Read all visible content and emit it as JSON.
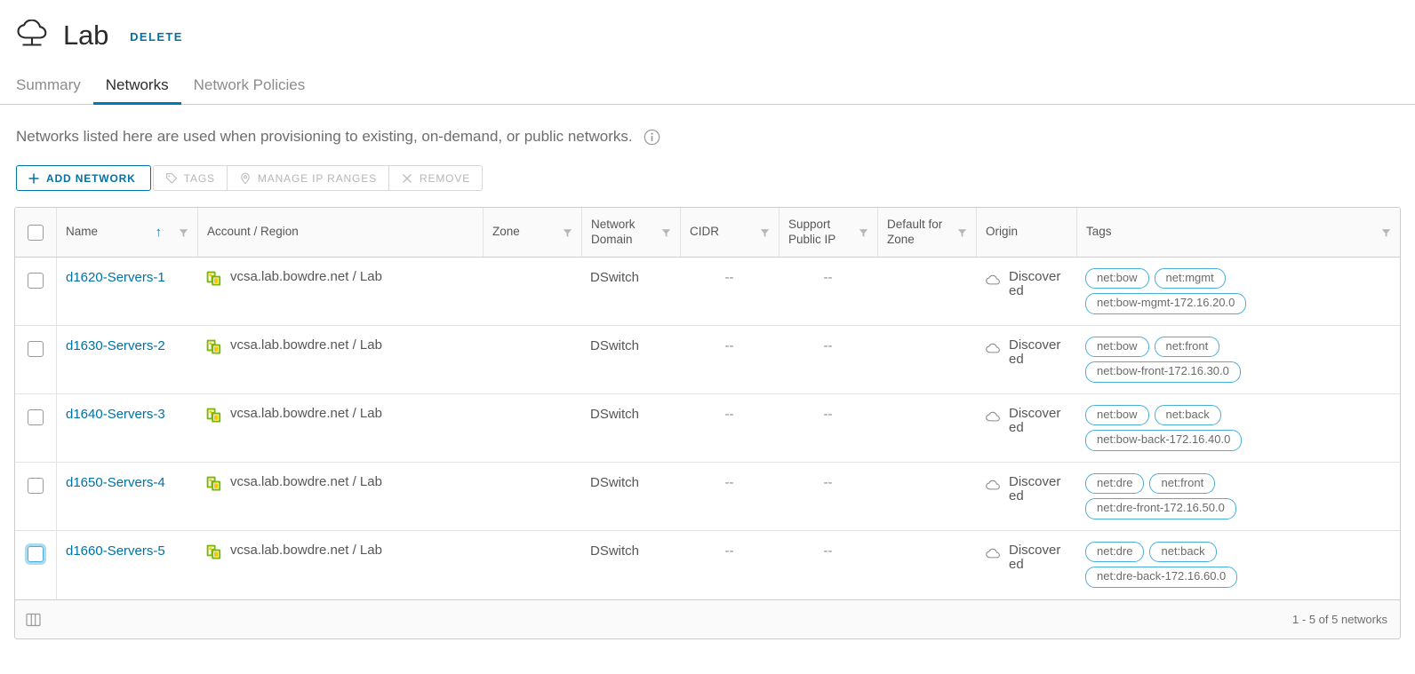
{
  "header": {
    "title": "Lab",
    "logo_icon": "cloud-icon",
    "delete_label": "DELETE"
  },
  "tabs": [
    {
      "label": "Summary",
      "active": false
    },
    {
      "label": "Networks",
      "active": true
    },
    {
      "label": "Network Policies",
      "active": false
    }
  ],
  "description": {
    "text": "Networks listed here are used when provisioning to existing, on-demand, or public networks.",
    "info_icon": "info-icon"
  },
  "toolbar": {
    "add_network_label": "ADD NETWORK",
    "tags_label": "TAGS",
    "manage_ip_ranges_label": "MANAGE IP RANGES",
    "remove_label": "REMOVE",
    "icons": {
      "add": "plus-icon",
      "tags": "tag-icon",
      "ip_ranges": "location-pin-icon",
      "remove": "close-x-icon"
    }
  },
  "table": {
    "columns": [
      {
        "label": "Name",
        "sorted": "asc",
        "filter": true
      },
      {
        "label": "Account / Region",
        "filter": false
      },
      {
        "label": "Zone",
        "filter": true
      },
      {
        "label": "Network Domain",
        "filter": true
      },
      {
        "label": "CIDR",
        "filter": true
      },
      {
        "label": "Support Public IP",
        "filter": true
      },
      {
        "label": "Default for Zone",
        "filter": true
      },
      {
        "label": "Origin",
        "filter": false
      },
      {
        "label": "Tags",
        "filter": true
      }
    ],
    "rows": [
      {
        "name": "d1620-Servers-1",
        "account_region": "vcsa.lab.bowdre.net / Lab",
        "zone": "",
        "network_domain": "DSwitch",
        "cidr": "--",
        "support_public_ip": "--",
        "default_for_zone": "",
        "origin": "Discovered",
        "tags": [
          "net:bow",
          "net:mgmt",
          "net:bow-mgmt-172.16.20.0"
        ],
        "checkbox_focused": false
      },
      {
        "name": "d1630-Servers-2",
        "account_region": "vcsa.lab.bowdre.net / Lab",
        "zone": "",
        "network_domain": "DSwitch",
        "cidr": "--",
        "support_public_ip": "--",
        "default_for_zone": "",
        "origin": "Discovered",
        "tags": [
          "net:bow",
          "net:front",
          "net:bow-front-172.16.30.0"
        ],
        "checkbox_focused": false
      },
      {
        "name": "d1640-Servers-3",
        "account_region": "vcsa.lab.bowdre.net / Lab",
        "zone": "",
        "network_domain": "DSwitch",
        "cidr": "--",
        "support_public_ip": "--",
        "default_for_zone": "",
        "origin": "Discovered",
        "tags": [
          "net:bow",
          "net:back",
          "net:bow-back-172.16.40.0"
        ],
        "checkbox_focused": false
      },
      {
        "name": "d1650-Servers-4",
        "account_region": "vcsa.lab.bowdre.net / Lab",
        "zone": "",
        "network_domain": "DSwitch",
        "cidr": "--",
        "support_public_ip": "--",
        "default_for_zone": "",
        "origin": "Discovered",
        "tags": [
          "net:dre",
          "net:front",
          "net:dre-front-172.16.50.0"
        ],
        "checkbox_focused": false
      },
      {
        "name": "d1660-Servers-5",
        "account_region": "vcsa.lab.bowdre.net / Lab",
        "zone": "",
        "network_domain": "DSwitch",
        "cidr": "--",
        "support_public_ip": "--",
        "default_for_zone": "",
        "origin": "Discovered",
        "tags": [
          "net:dre",
          "net:back",
          "net:dre-back-172.16.60.0"
        ],
        "checkbox_focused": true
      }
    ]
  },
  "footer": {
    "panel_icon": "column-panel-icon",
    "pagination_text": "1 - 5 of 5 networks"
  },
  "colors": {
    "accent": "#0079b8",
    "link": "#0072a3",
    "tag_border": "#49afd9",
    "text": "#565656",
    "muted": "#8c8c8c"
  }
}
